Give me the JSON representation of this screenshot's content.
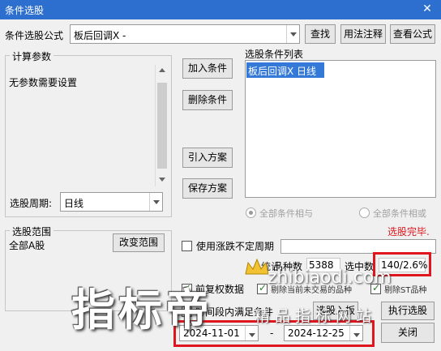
{
  "window": {
    "title": "条件选股",
    "close_glyph": "✕"
  },
  "formula": {
    "label": "条件选股公式",
    "value": "板后回调X  -"
  },
  "buttons": {
    "find": "查找",
    "usage": "用法注释",
    "view_formula": "查看公式",
    "add_condition": "加入条件",
    "delete_condition": "删除条件",
    "import_plan": "引入方案",
    "save_plan": "保存方案",
    "change_range": "改变范围",
    "pick_to_block": "选股入板",
    "execute": "执行选股",
    "close": "关闭"
  },
  "params": {
    "group_label": "计算参数",
    "text": "无参数需要设置"
  },
  "period": {
    "label": "选股周期:",
    "value": "日线"
  },
  "conditions": {
    "group_label": "选股条件列表",
    "items": [
      "板后回调X  日线"
    ],
    "and_label": "全部条件相与",
    "or_label": "全部条件相或"
  },
  "status": {
    "done": "选股完毕."
  },
  "range": {
    "group_label": "选股范围",
    "value": "全部A股"
  },
  "options": {
    "variable_period": "使用涨跌不定周期",
    "restore_rights": "前复权数据",
    "stats_label": "统计",
    "include_special": "剔除当前未交易的品种",
    "exclude_st": "剔除ST品种"
  },
  "stats": {
    "count_label": "品种数",
    "count_value": "5388",
    "selected_label": "选中数",
    "selected_value": "140/2.6%"
  },
  "time_range": {
    "label": "时间段内满足条件",
    "start": "2024-11-01",
    "end": "2024-12-25",
    "separator": "-"
  },
  "watermark": {
    "big": "指标帝",
    "small": "精品指标网站",
    "latin": "zhibiaodi.com"
  },
  "colors": {
    "titlebar": "#2c6fcf",
    "selection": "#3478d8",
    "accent_red": "#e0161e",
    "status_red": "#e0161e"
  }
}
